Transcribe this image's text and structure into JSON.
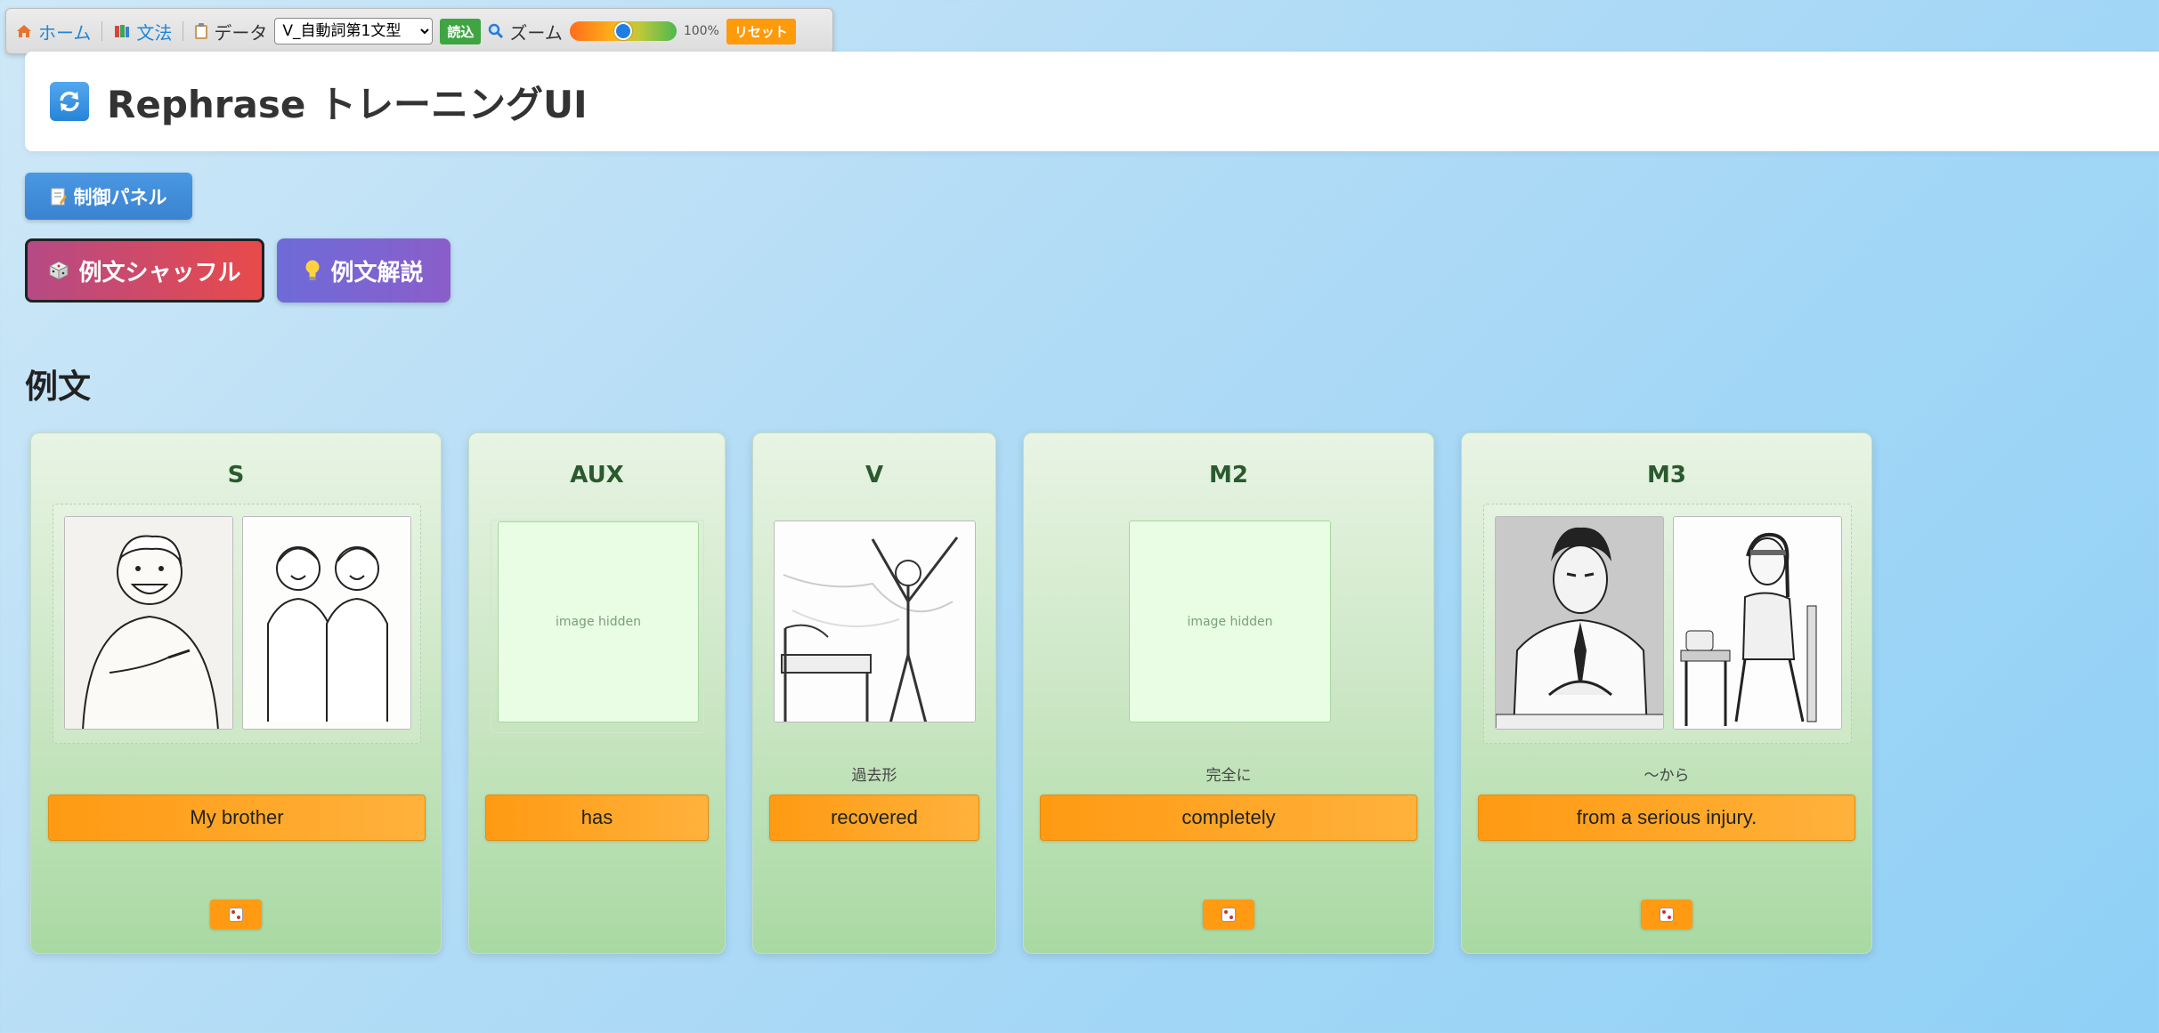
{
  "toolbar": {
    "home_label": "ホーム",
    "grammar_label": "文法",
    "data_label": "データ",
    "data_select_value": "V_自動詞第1文型",
    "load_label": "読込",
    "zoom_label": "ズーム",
    "zoom_value": "100%",
    "zoom_level": 0.5,
    "reset_label": "リセット"
  },
  "header": {
    "title": "Rephrase トレーニングUI"
  },
  "buttons": {
    "control_panel": "制御パネル",
    "shuffle": "例文シャッフル",
    "explain": "例文解説"
  },
  "section_title": "例文",
  "hidden_image_text": "image hidden",
  "slots": [
    {
      "label": "S",
      "sub": "",
      "word": "My brother"
    },
    {
      "label": "AUX",
      "sub": "",
      "word": "has"
    },
    {
      "label": "V",
      "sub": "過去形",
      "word": "recovered"
    },
    {
      "label": "M2",
      "sub": "完全に",
      "word": "completely"
    },
    {
      "label": "M3",
      "sub": "〜から",
      "word": "from a serious injury."
    }
  ],
  "colors": {
    "accent_blue": "#3a83d0",
    "word_orange": "#ff9a12",
    "card_green": "#cfe8c8"
  }
}
